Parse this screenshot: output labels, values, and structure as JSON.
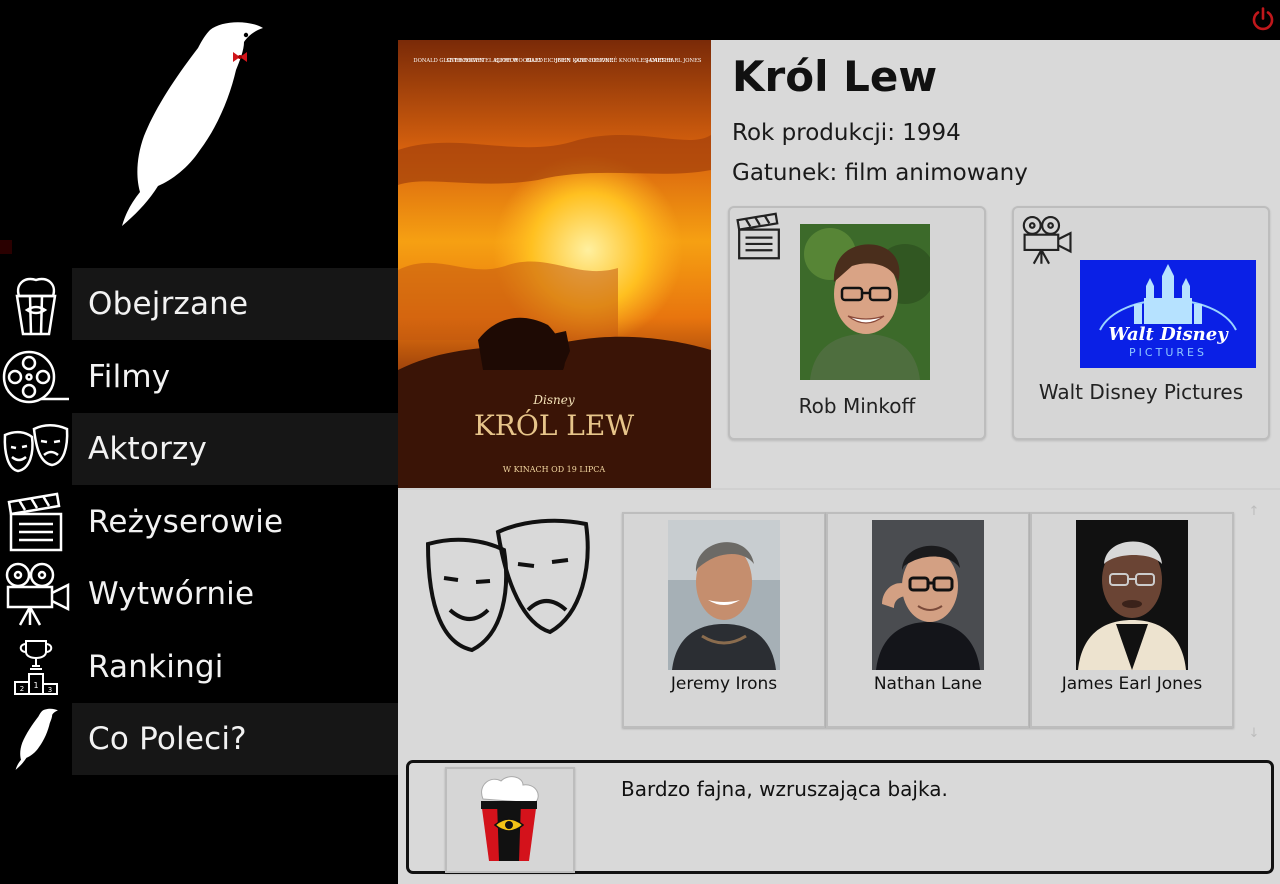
{
  "nav": {
    "items": [
      {
        "label": "Obejrzane",
        "icon": "popcorn-icon"
      },
      {
        "label": "Filmy",
        "icon": "film-reel-icon"
      },
      {
        "label": "Aktorzy",
        "icon": "theater-masks-icon"
      },
      {
        "label": "Reżyserowie",
        "icon": "clapperboard-icon"
      },
      {
        "label": "Wytwórnie",
        "icon": "movie-camera-icon"
      },
      {
        "label": "Rankingi",
        "icon": "trophy-podium-icon"
      },
      {
        "label": "Co Poleci?",
        "icon": "bird-icon"
      }
    ]
  },
  "movie": {
    "title": "Król Lew",
    "year_text": "Rok produkcji: 1994",
    "genre_text": "Gatunek: film animowany",
    "poster": {
      "credits": [
        "DONALD GLOVER",
        "SETH ROGEN",
        "CHIWETEL EJIOFOR",
        "ALFRE WOODARD",
        "BILLY EICHNER",
        "JOHN KANI",
        "JOHN OLIVER",
        "BEYONCÉ KNOWLES-CARTER",
        "JAMES EARL JONES"
      ],
      "brand": "Disney",
      "title": "KRÓL LEW",
      "tagline": "W KINACH OD 19 LIPCA"
    }
  },
  "director": {
    "name": "Rob Minkoff",
    "icon": "clapperboard-icon"
  },
  "studio": {
    "name": "Walt Disney Pictures",
    "icon": "movie-camera-icon",
    "logo_text": "Walt Disney",
    "logo_sub": "PICTURES",
    "logo_bg": "#0a20e6"
  },
  "actors_section_icon": "theater-masks-icon",
  "actors": [
    {
      "name": "Jeremy Irons"
    },
    {
      "name": "Nathan Lane"
    },
    {
      "name": "James Earl Jones"
    }
  ],
  "review": {
    "text": "Bardzo fajna, wzruszająca bajka.",
    "icon": "popcorn-eye-icon"
  },
  "colors": {
    "power": "#c0171b",
    "sidebar_bg": "#000000",
    "content_bg": "#d9d9d9"
  },
  "icons": {
    "power": "power-icon",
    "logo": "bird-logo-icon",
    "scroll_up": "arrow-up-icon",
    "scroll_down": "arrow-down-icon"
  },
  "scroll": {
    "up": "↑",
    "down": "↓"
  }
}
